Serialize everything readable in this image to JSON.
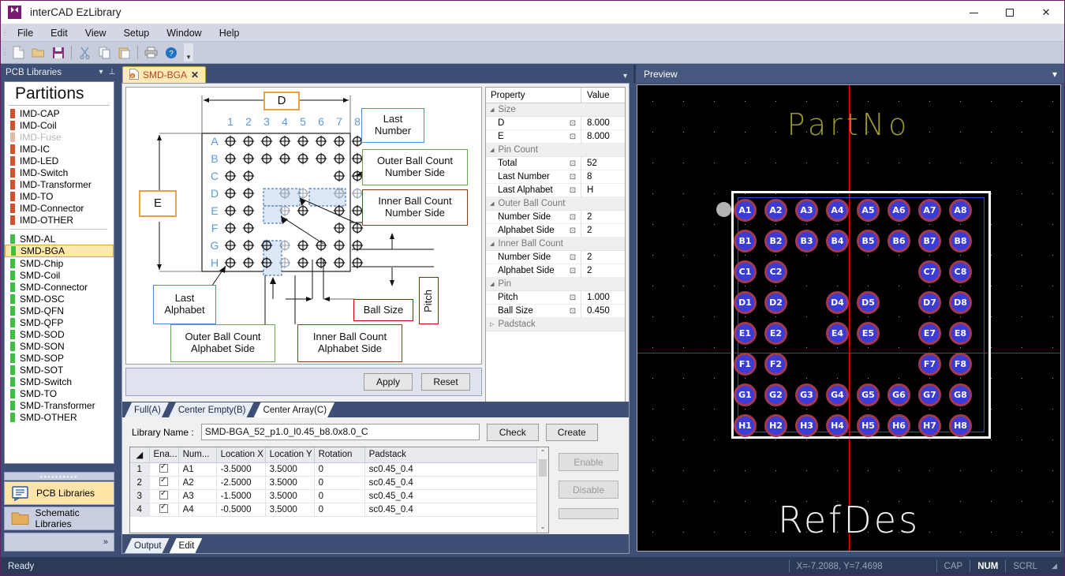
{
  "window": {
    "title": "interCAD EzLibrary",
    "icon": "app-icon",
    "minimize": "–",
    "maximize": "□",
    "close": "✕"
  },
  "menu": [
    "File",
    "Edit",
    "View",
    "Setup",
    "Window",
    "Help"
  ],
  "toolbar": {
    "items": [
      "new-icon",
      "open-icon",
      "save-icon",
      "cut-icon",
      "copy-icon",
      "paste-icon",
      "print-icon",
      "help-icon"
    ],
    "overflow": "▾"
  },
  "left_dock": {
    "header": "PCB Libraries",
    "collapse_icon": "▾",
    "pin_icon": "⊥",
    "partitions_title": "Partitions",
    "groups": [
      {
        "color": "#d1532e",
        "items": [
          {
            "label": "IMD-CAP",
            "disabled": false
          },
          {
            "label": "IMD-Coil",
            "disabled": false
          },
          {
            "label": "IMD-Fuse",
            "disabled": true
          },
          {
            "label": "IMD-IC",
            "disabled": false
          },
          {
            "label": "IMD-LED",
            "disabled": false
          },
          {
            "label": "IMD-Switch",
            "disabled": false
          },
          {
            "label": "IMD-Transformer",
            "disabled": false
          },
          {
            "label": "IMD-TO",
            "disabled": false
          },
          {
            "label": "IMD-Connector",
            "disabled": false
          },
          {
            "label": "IMD-OTHER",
            "disabled": false
          }
        ]
      },
      {
        "color": "#3fbf3f",
        "items": [
          {
            "label": "SMD-AL",
            "disabled": false
          },
          {
            "label": "SMD-BGA",
            "disabled": false,
            "selected": true
          },
          {
            "label": "SMD-Chip",
            "disabled": false
          },
          {
            "label": "SMD-Coil",
            "disabled": false
          },
          {
            "label": "SMD-Connector",
            "disabled": false
          },
          {
            "label": "SMD-OSC",
            "disabled": false
          },
          {
            "label": "SMD-QFN",
            "disabled": false
          },
          {
            "label": "SMD-QFP",
            "disabled": false
          },
          {
            "label": "SMD-SOD",
            "disabled": false
          },
          {
            "label": "SMD-SON",
            "disabled": false
          },
          {
            "label": "SMD-SOP",
            "disabled": false
          },
          {
            "label": "SMD-SOT",
            "disabled": false
          },
          {
            "label": "SMD-Switch",
            "disabled": false
          },
          {
            "label": "SMD-TO",
            "disabled": false
          },
          {
            "label": "SMD-Transformer",
            "disabled": false
          },
          {
            "label": "SMD-OTHER",
            "disabled": false
          }
        ]
      }
    ],
    "buttons": [
      {
        "label": "PCB Libraries",
        "icon": "pcb-libraries-icon",
        "active": true
      },
      {
        "label": "Schematic Libraries",
        "icon": "folder-icon",
        "active": false
      }
    ],
    "expand_icon": "»"
  },
  "document": {
    "tab_label": "SMD-BGA",
    "tab_icon": "bga-file-icon",
    "tab_close": "✕",
    "tabs_caret": "▾"
  },
  "diagram": {
    "dim_d": "D",
    "dim_e": "E",
    "column_labels": [
      "1",
      "2",
      "3",
      "4",
      "5",
      "6",
      "7",
      "8"
    ],
    "row_labels": [
      "A",
      "B",
      "C",
      "D",
      "E",
      "F",
      "G",
      "H"
    ],
    "callouts": [
      {
        "id": "last-number",
        "text": "Last\nNumber",
        "color": "#4a90d9"
      },
      {
        "id": "outer-ball-count-number-side",
        "text": "Outer Ball Count\nNumber Side",
        "color": "#6aa84f"
      },
      {
        "id": "inner-ball-count-number-side",
        "text": "Inner Ball Count\nNumber Side",
        "color": "#8b3a1a"
      },
      {
        "id": "ball-size",
        "text": "Ball Size",
        "color": "#cc0000"
      },
      {
        "id": "pitch",
        "text": "Pitch",
        "color": "#cc0000"
      },
      {
        "id": "last-alphabet",
        "text": "Last\nAlphabet",
        "color": "#4a90d9"
      },
      {
        "id": "outer-ball-count-alphabet-side",
        "text": "Outer Ball Count\nAlphabet Side",
        "color": "#6aa84f"
      },
      {
        "id": "inner-ball-count-alphabet-side",
        "text": "Inner Ball Count\nAlphabet Side",
        "color": "#8b3a1a"
      }
    ],
    "ball_grid": [
      [
        1,
        1,
        1,
        1,
        1,
        1,
        1,
        1
      ],
      [
        1,
        1,
        1,
        1,
        1,
        1,
        1,
        1
      ],
      [
        1,
        1,
        0,
        0,
        0,
        0,
        1,
        1
      ],
      [
        1,
        1,
        0,
        2,
        2,
        0,
        2,
        2
      ],
      [
        1,
        1,
        0,
        2,
        1,
        0,
        1,
        1
      ],
      [
        1,
        1,
        0,
        0,
        0,
        0,
        1,
        1
      ],
      [
        1,
        1,
        1,
        2,
        1,
        1,
        1,
        1
      ],
      [
        1,
        1,
        1,
        2,
        1,
        1,
        1,
        1
      ]
    ]
  },
  "properties": {
    "col_property": "Property",
    "col_value": "Value",
    "expand_icon": "◢",
    "collapsed_icon": "▷",
    "edit_icon": "⊡",
    "rows": [
      {
        "type": "category",
        "name": "Size"
      },
      {
        "type": "item",
        "name": "D",
        "value": "8.000"
      },
      {
        "type": "item",
        "name": "E",
        "value": "8.000"
      },
      {
        "type": "category",
        "name": "Pin Count"
      },
      {
        "type": "item",
        "name": "Total",
        "value": "52"
      },
      {
        "type": "item",
        "name": "Last Number",
        "value": "8"
      },
      {
        "type": "item",
        "name": "Last Alphabet",
        "value": "H"
      },
      {
        "type": "category",
        "name": "Outer Ball Count"
      },
      {
        "type": "item",
        "name": "Number Side",
        "value": "2"
      },
      {
        "type": "item",
        "name": "Alphabet Side",
        "value": "2"
      },
      {
        "type": "category",
        "name": "Inner Ball Count"
      },
      {
        "type": "item",
        "name": "Number Side",
        "value": "2"
      },
      {
        "type": "item",
        "name": "Alphabet Side",
        "value": "2"
      },
      {
        "type": "category",
        "name": "Pin"
      },
      {
        "type": "item",
        "name": "Pitch",
        "value": "1.000"
      },
      {
        "type": "item",
        "name": "Ball Size",
        "value": "0.450"
      },
      {
        "type": "category_collapsed",
        "name": "Padstack"
      }
    ]
  },
  "actions": {
    "apply": "Apply",
    "reset": "Reset"
  },
  "sub_tabs": [
    {
      "label": "Full(A)",
      "active": false
    },
    {
      "label": "Center Empty(B)",
      "active": false
    },
    {
      "label": "Center Array(C)",
      "active": true
    }
  ],
  "library": {
    "label": "Library Name :",
    "value": "SMD-BGA_52_p1.0_l0.45_b8.0x8.0_C",
    "check": "Check",
    "create": "Create"
  },
  "pin_table": {
    "columns": [
      "Ena...",
      "Num...",
      "Location X",
      "Location Y",
      "Rotation",
      "Padstack"
    ],
    "corner_icon": "◢",
    "scroll_up": "⌃",
    "scroll_down": "⌄",
    "rows": [
      {
        "n": "1",
        "enabled": true,
        "number": "A1",
        "x": "-3.5000",
        "y": "3.5000",
        "rot": "0",
        "padstack": "sc0.45_0.4"
      },
      {
        "n": "2",
        "enabled": true,
        "number": "A2",
        "x": "-2.5000",
        "y": "3.5000",
        "rot": "0",
        "padstack": "sc0.45_0.4"
      },
      {
        "n": "3",
        "enabled": true,
        "number": "A3",
        "x": "-1.5000",
        "y": "3.5000",
        "rot": "0",
        "padstack": "sc0.45_0.4"
      },
      {
        "n": "4",
        "enabled": true,
        "number": "A4",
        "x": "-0.5000",
        "y": "3.5000",
        "rot": "0",
        "padstack": "sc0.45_0.4"
      }
    ],
    "side_buttons": [
      {
        "label": "Enable",
        "disabled": true
      },
      {
        "label": "Disable",
        "disabled": true
      }
    ]
  },
  "output_tabs": [
    {
      "label": "Output",
      "active": false
    },
    {
      "label": "Edit",
      "active": true
    }
  ],
  "preview": {
    "header": "Preview",
    "caret": "▾",
    "part_no": "PartNo",
    "ref_des": "RefDes",
    "colors": {
      "background": "#000000",
      "pad_fill": "#3b3bd6",
      "pad_ring": "#a33a52",
      "courtyard": "#2a4fd6",
      "body_outline": "#ffffff",
      "crosshair": "#e00000",
      "part_no": "#9a9a33",
      "ref_des": "#f2f2f2"
    },
    "pads": [
      "A1",
      "A2",
      "A3",
      "A4",
      "A5",
      "A6",
      "A7",
      "A8",
      "B1",
      "B2",
      "B3",
      "B4",
      "B5",
      "B6",
      "B7",
      "B8",
      "C1",
      "C2",
      "C7",
      "C8",
      "D1",
      "D2",
      "D4",
      "D5",
      "D7",
      "D8",
      "E1",
      "E2",
      "E4",
      "E5",
      "E7",
      "E8",
      "F1",
      "F2",
      "F7",
      "F8",
      "G1",
      "G2",
      "G3",
      "G4",
      "G5",
      "G6",
      "G7",
      "G8",
      "H1",
      "H2",
      "H3",
      "H4",
      "H5",
      "H6",
      "H7",
      "H8"
    ],
    "pad_matrix": [
      [
        "A1",
        "A2",
        "A3",
        "A4",
        "A5",
        "A6",
        "A7",
        "A8"
      ],
      [
        "B1",
        "B2",
        "B3",
        "B4",
        "B5",
        "B6",
        "B7",
        "B8"
      ],
      [
        "C1",
        "C2",
        "",
        "",
        "",
        "",
        "C7",
        "C8"
      ],
      [
        "D1",
        "D2",
        "",
        "D4",
        "D5",
        "",
        "D7",
        "D8"
      ],
      [
        "E1",
        "E2",
        "",
        "E4",
        "E5",
        "",
        "E7",
        "E8"
      ],
      [
        "F1",
        "F2",
        "",
        "",
        "",
        "",
        "F7",
        "F8"
      ],
      [
        "G1",
        "G2",
        "G3",
        "G4",
        "G5",
        "G6",
        "G7",
        "G8"
      ],
      [
        "H1",
        "H2",
        "H3",
        "H4",
        "H5",
        "H6",
        "H7",
        "H8"
      ]
    ]
  },
  "status": {
    "ready": "Ready",
    "coords": "X=-7.2088, Y=7.4698",
    "cap": "CAP",
    "num": "NUM",
    "scrl": "SCRL",
    "grip": "◢"
  }
}
